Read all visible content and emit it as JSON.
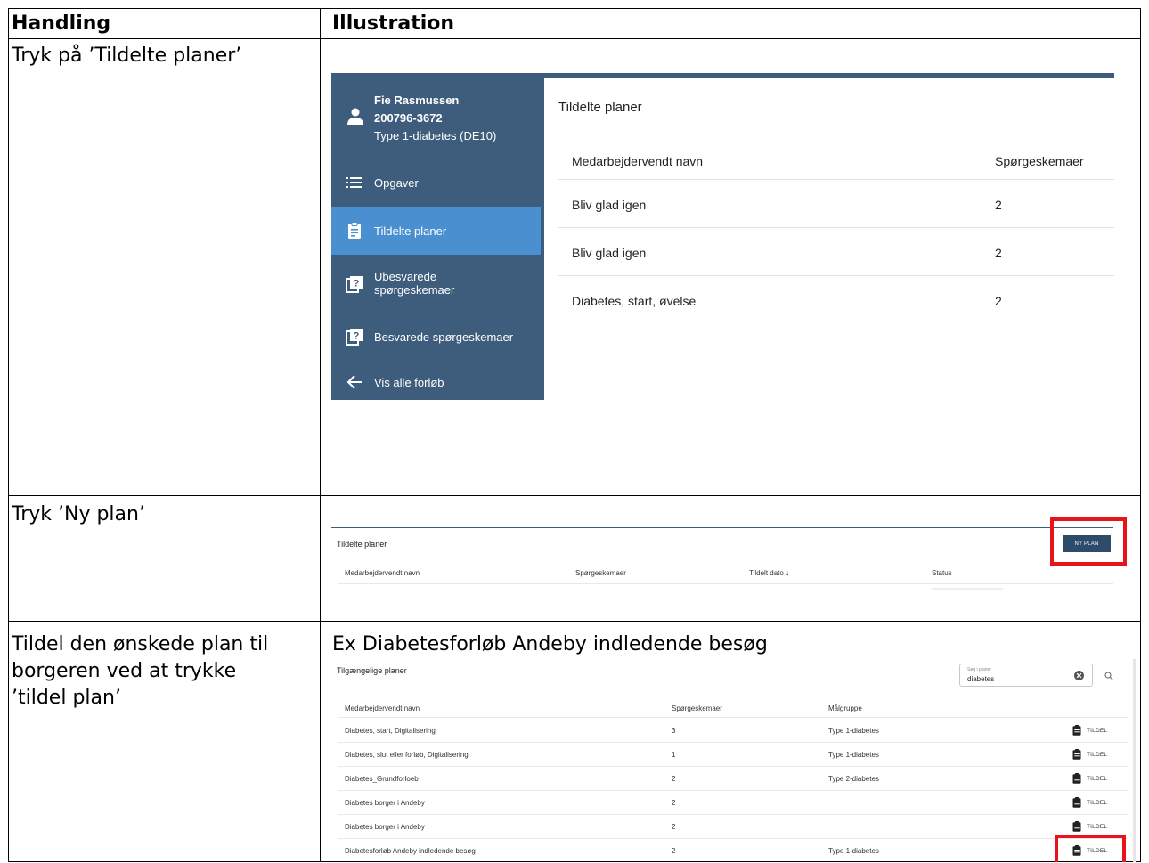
{
  "table": {
    "header_left": "Handling",
    "header_right": "Illustration",
    "row1_left": "Tryk på ’Tildelte planer’",
    "row2_left": "Tryk ’Ny plan’",
    "row3_left": [
      "Tildel den ønskede plan til",
      "borgeren ved at trykke",
      "’tildel plan’"
    ],
    "row3_right_caption": "Ex Diabetesforløb Andeby indledende besøg"
  },
  "illustration1": {
    "patient": {
      "name": "Fie Rasmussen",
      "cpr": "200796-3672",
      "diagnosis": "Type 1-diabetes (DE10)"
    },
    "nav": [
      {
        "label": "Opgaver",
        "icon": "list-icon",
        "active": false
      },
      {
        "label": "Tildelte planer",
        "icon": "clipboard-icon",
        "active": true
      },
      {
        "label_lines": [
          "Ubesvarede",
          "spørgeskemaer"
        ],
        "icon": "questionnaire-icon",
        "active": false
      },
      {
        "label": "Besvarede spørgeskemaer",
        "icon": "questionnaire-icon",
        "active": false
      },
      {
        "label": "Vis alle forløb",
        "icon": "arrow-left-icon",
        "active": false
      }
    ],
    "title": "Tildelte planer",
    "columns": [
      "Medarbejdervendt navn",
      "Spørgeskemaer"
    ],
    "rows": [
      {
        "name": "Bliv glad igen",
        "count": "2"
      },
      {
        "name": "Bliv glad igen",
        "count": "2"
      },
      {
        "name": "Diabetes, start, øvelse",
        "count": "2"
      }
    ]
  },
  "illustration2": {
    "title": "Tildelte planer",
    "button": "NY PLAN",
    "columns": [
      "Medarbejdervendt navn",
      "Spørgeskemaer",
      "Tildelt dato ↓",
      "Status"
    ]
  },
  "illustration3": {
    "title": "Tilgængelige planer",
    "search": {
      "placeholder": "Søg i planer",
      "value": "diabetes"
    },
    "columns": [
      "Medarbejdervendt navn",
      "Spørgeskemaer",
      "Målgruppe"
    ],
    "action_label": "TILDEL",
    "rows": [
      {
        "name": "Diabetes, start, Digitalisering",
        "count": "3",
        "group": "Type 1-diabetes"
      },
      {
        "name": "Diabetes, slut eller forløb, Digitalisering",
        "count": "1",
        "group": "Type 1-diabetes"
      },
      {
        "name": "Diabetes_Grundforloeb",
        "count": "2",
        "group": "Type 2-diabetes"
      },
      {
        "name": "Diabetes borger i Andeby",
        "count": "2",
        "group": ""
      },
      {
        "name": "Diabetes borger i Andeby",
        "count": "2",
        "group": ""
      },
      {
        "name": "Diabetesforløb Andeby indledende besøg",
        "count": "2",
        "group": "Type 1-diabetes"
      }
    ]
  },
  "colors": {
    "sidebar": "#3e5d7c",
    "active_nav": "#4a8fd0",
    "button": "#2f4b6b",
    "highlight": "#e8141c"
  }
}
